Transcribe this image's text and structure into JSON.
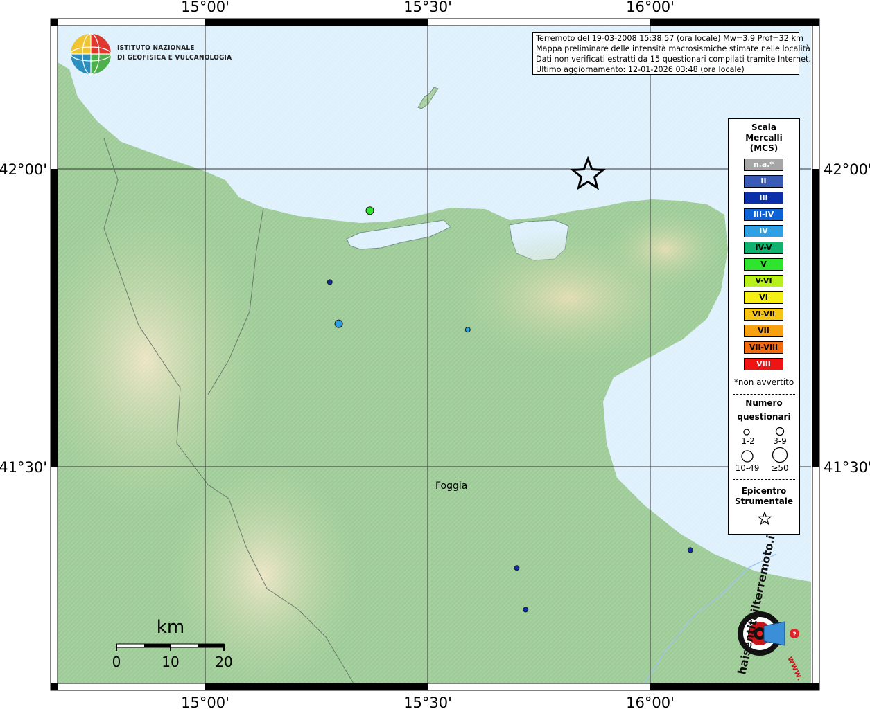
{
  "institute": {
    "line1": "ISTITUTO NAZIONALE",
    "line2": "DI GEOFISICA E VULCANOLOGIA"
  },
  "info": {
    "line1": "Terremoto del 19-03-2008 15:38:57 (ora locale) Mw=3.9 Prof=32 km",
    "line2": "Mappa preliminare delle intensità macrosismiche stimate nelle località",
    "line3": "Dati non verificati estratti da 15 questionari compilati tramite Internet.",
    "line4": "Ultimo aggiornamento: 12-01-2026 03:48 (ora locale)"
  },
  "axes": {
    "top": [
      "15°00'",
      "15°30'",
      "16°00'"
    ],
    "bottom": [
      "15°00'",
      "15°30'",
      "16°00'"
    ],
    "left": [
      "42°00'",
      "41°30'"
    ],
    "right": [
      "42°00'",
      "41°30'"
    ]
  },
  "legend": {
    "title_lines": [
      "Scala",
      "Mercalli",
      "(MCS)"
    ],
    "intensity_scale": [
      {
        "label": "n.a.*",
        "color": "#a6a6a6",
        "text_color": "#ffffff"
      },
      {
        "label": "II",
        "color": "#3a5bb5",
        "text_color": "#ffffff"
      },
      {
        "label": "III",
        "color": "#0b2fa8",
        "text_color": "#ffffff"
      },
      {
        "label": "III-IV",
        "color": "#0d63d6",
        "text_color": "#ffffff"
      },
      {
        "label": "IV",
        "color": "#2fa0e4",
        "text_color": "#ffffff"
      },
      {
        "label": "IV-V",
        "color": "#11b16f",
        "text_color": "#000000"
      },
      {
        "label": "V",
        "color": "#2ee42e",
        "text_color": "#000000"
      },
      {
        "label": "V-VI",
        "color": "#b8f01a",
        "text_color": "#000000"
      },
      {
        "label": "VI",
        "color": "#f6ef16",
        "text_color": "#000000"
      },
      {
        "label": "VI-VII",
        "color": "#f6c413",
        "text_color": "#000000"
      },
      {
        "label": "VII",
        "color": "#f6a012",
        "text_color": "#000000"
      },
      {
        "label": "VII-VIII",
        "color": "#f26a10",
        "text_color": "#000000"
      },
      {
        "label": "VIII",
        "color": "#ef1414",
        "text_color": "#ffffff"
      }
    ],
    "not_felt_note": "*non avvertito",
    "questionnaire_title_1": "Numero",
    "questionnaire_title_2": "questionari",
    "sizes": [
      "1-2",
      "3-9",
      "10-49",
      "≥50"
    ],
    "epicenter_title_1": "Epicentro",
    "epicenter_title_2": "Strumentale"
  },
  "places": [
    {
      "name": "Foggia"
    }
  ],
  "observations": [
    {
      "lon": 15.37,
      "lat": 41.93,
      "intensity": "V",
      "color": "#2ee42e",
      "count": "3-9"
    },
    {
      "lon": 15.28,
      "lat": 41.81,
      "intensity": "III",
      "color": "#0b2fa8",
      "count": "1-2"
    },
    {
      "lon": 15.3,
      "lat": 41.74,
      "intensity": "IV",
      "color": "#2fa0e4",
      "count": "3-9"
    },
    {
      "lon": 15.59,
      "lat": 41.73,
      "intensity": "IV",
      "color": "#2fa0e4",
      "count": "1-2"
    },
    {
      "lon": 15.7,
      "lat": 41.33,
      "intensity": "III",
      "color": "#0b2fa8",
      "count": "1-2"
    },
    {
      "lon": 15.72,
      "lat": 41.26,
      "intensity": "III",
      "color": "#0b2fa8",
      "count": "1-2"
    },
    {
      "lon": 16.09,
      "lat": 41.36,
      "intensity": "III",
      "color": "#0b2fa8",
      "count": "1-2"
    }
  ],
  "epicenter": {
    "lon": 15.86,
    "lat": 41.99
  },
  "scale_bar": {
    "unit": "km",
    "ticks": [
      "0",
      "10",
      "20"
    ]
  },
  "site_logo": {
    "text": "haisentitoilterremoto.it",
    "url_text": "www."
  },
  "colors": {
    "sea": "#dff0fd",
    "land_low": "#93c795",
    "land_mid": "#b5d39a",
    "land_high": "#e8dcb0",
    "frame": "#000000"
  }
}
